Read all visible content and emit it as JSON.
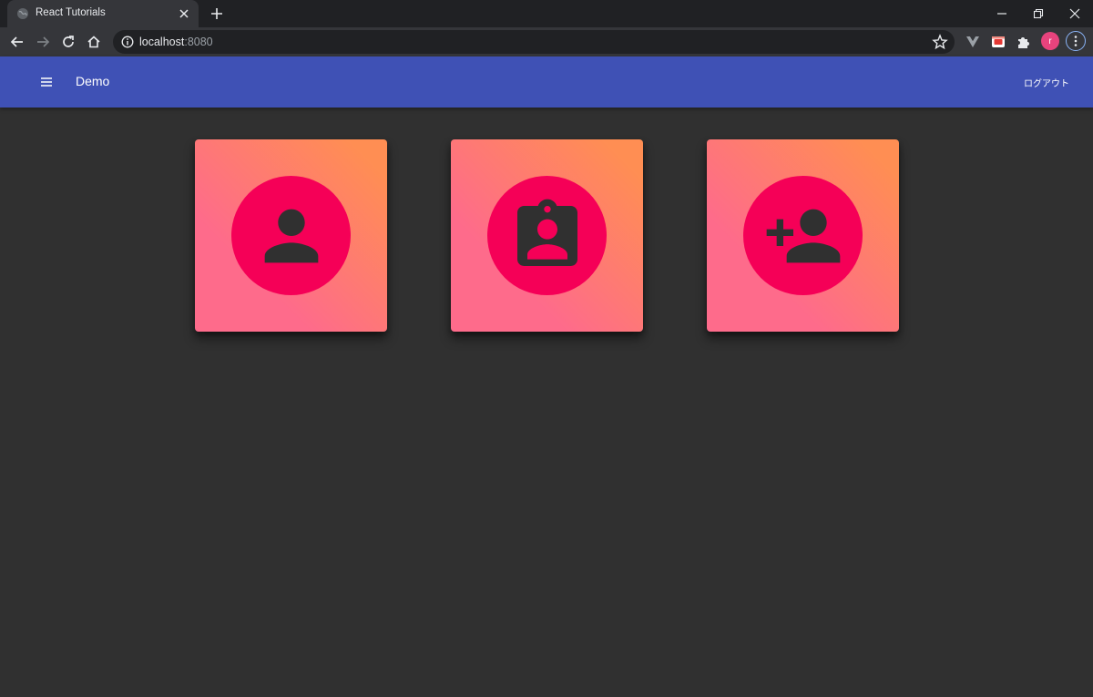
{
  "browser": {
    "tab_title": "React Tutorials",
    "url_host": "localhost",
    "url_port": ":8080",
    "profile_initial": "r"
  },
  "appbar": {
    "title": "Demo",
    "logout_label": "ログアウト",
    "color": "#3f51b5"
  },
  "cards": [
    {
      "icon": "person-icon"
    },
    {
      "icon": "contact-badge-icon"
    },
    {
      "icon": "person-add-icon"
    }
  ],
  "colors": {
    "background": "#303030",
    "card_gradient_start": "#fe6b8b",
    "card_gradient_end": "#ff8e53",
    "avatar": "#f50057",
    "icon": "#303030"
  }
}
